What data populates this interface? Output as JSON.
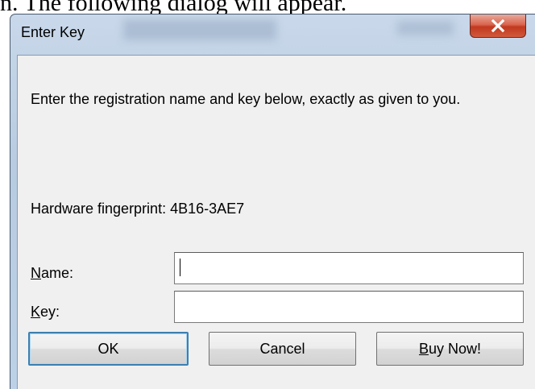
{
  "page": {
    "caption": "n. The following dialog will appear."
  },
  "dialog": {
    "title": "Enter Key",
    "close_label": "X",
    "instructions": "Enter the registration name and key below, exactly as given to you.",
    "fingerprint_label": "Hardware fingerprint:",
    "fingerprint_value": "4B16-3AE7",
    "fields": {
      "name": {
        "label_access": "N",
        "label_rest": "ame:",
        "value": "",
        "placeholder": ""
      },
      "key": {
        "label_access": "K",
        "label_rest": "ey:",
        "value": "",
        "placeholder": ""
      }
    },
    "buttons": {
      "ok": "OK",
      "cancel": "Cancel",
      "buy_access": "B",
      "buy_rest": "uy Now!"
    }
  }
}
